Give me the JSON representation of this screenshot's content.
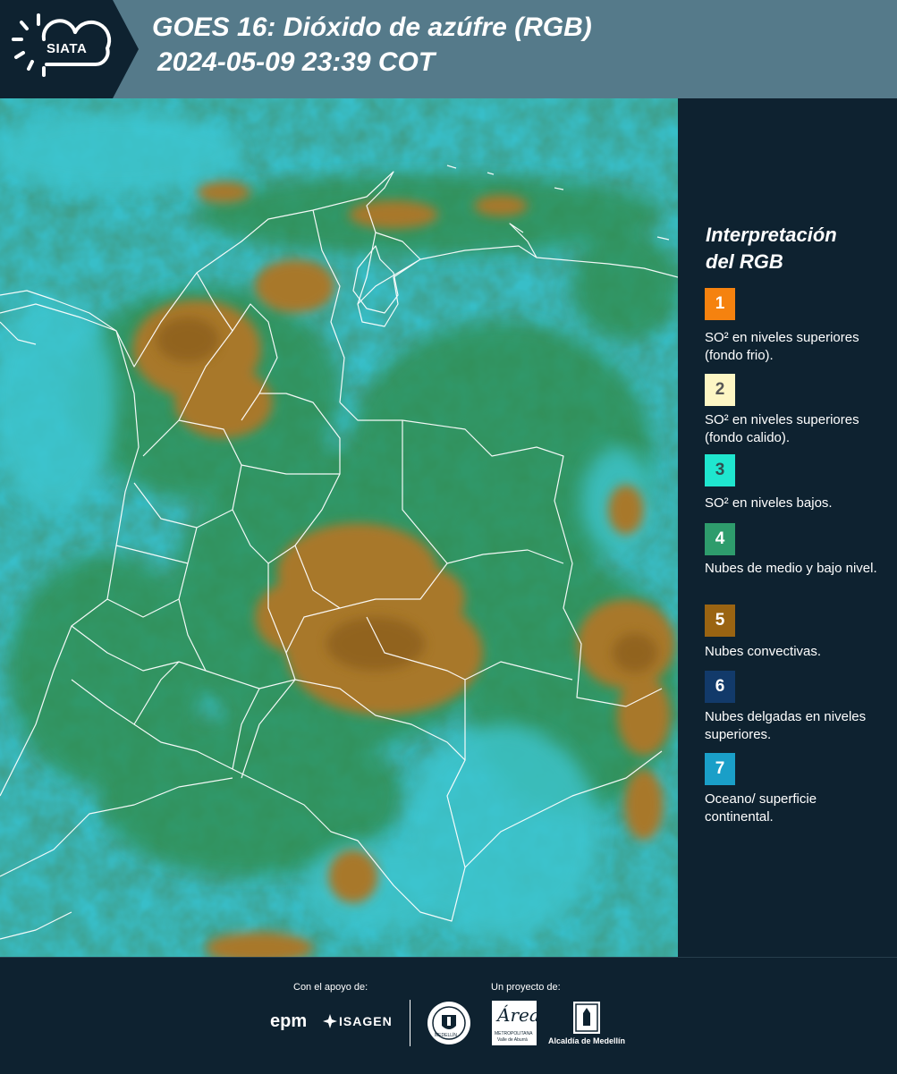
{
  "header": {
    "logo_text": "SIATA",
    "title_line1": "GOES 16: Dióxido de azúfre (RGB)",
    "title_line2": "2024-05-09 23:39 COT"
  },
  "legend": {
    "title_line1": "Interpretación",
    "title_line2": "del RGB",
    "items": [
      {
        "number": "1",
        "color": "#f5820f",
        "text_color": "#ffffff",
        "label": "SO² en niveles superiores (fondo frio)."
      },
      {
        "number": "2",
        "color": "#fdf6c4",
        "text_color": "#555555",
        "label": "SO² en niveles superiores (fondo calido)."
      },
      {
        "number": "3",
        "color": "#1fe6cf",
        "text_color": "#2f4f4f",
        "label": "SO² en niveles bajos."
      },
      {
        "number": "4",
        "color": "#2e9c6c",
        "text_color": "#ffffff",
        "label": "Nubes de medio y bajo nivel."
      },
      {
        "number": "5",
        "color": "#9a6412",
        "text_color": "#ffffff",
        "label": "Nubes convectivas."
      },
      {
        "number": "6",
        "color": "#123a6a",
        "text_color": "#ffffff",
        "label": "Nubes delgadas en niveles superiores."
      },
      {
        "number": "7",
        "color": "#1a9fc8",
        "text_color": "#ffffff",
        "label": "Oceano/ superficie continental."
      }
    ]
  },
  "footer": {
    "support_caption": "Con el apoyo de:",
    "project_caption": "Un proyecto de:",
    "logos": {
      "epm": "epm",
      "isagen": "ISAGEN",
      "medellin_seal": "MEDELLÍN",
      "area_script": "Área",
      "area_sub1": "METROPOLITANA",
      "area_sub2": "Valle de Aburrá",
      "alcaldia": "Alcaldía de Medellín"
    }
  },
  "colors": {
    "background": "#0e2230",
    "header": "#557a8a",
    "map_cyan": "#36bcc6",
    "map_green": "#2d8a4e",
    "map_convective": "#a8782c",
    "borders": "#ffffff"
  },
  "icons": [
    "siata-sun-cloud-icon",
    "isagen-icon",
    "medellin-seal-icon",
    "alcaldia-crest-icon"
  ]
}
